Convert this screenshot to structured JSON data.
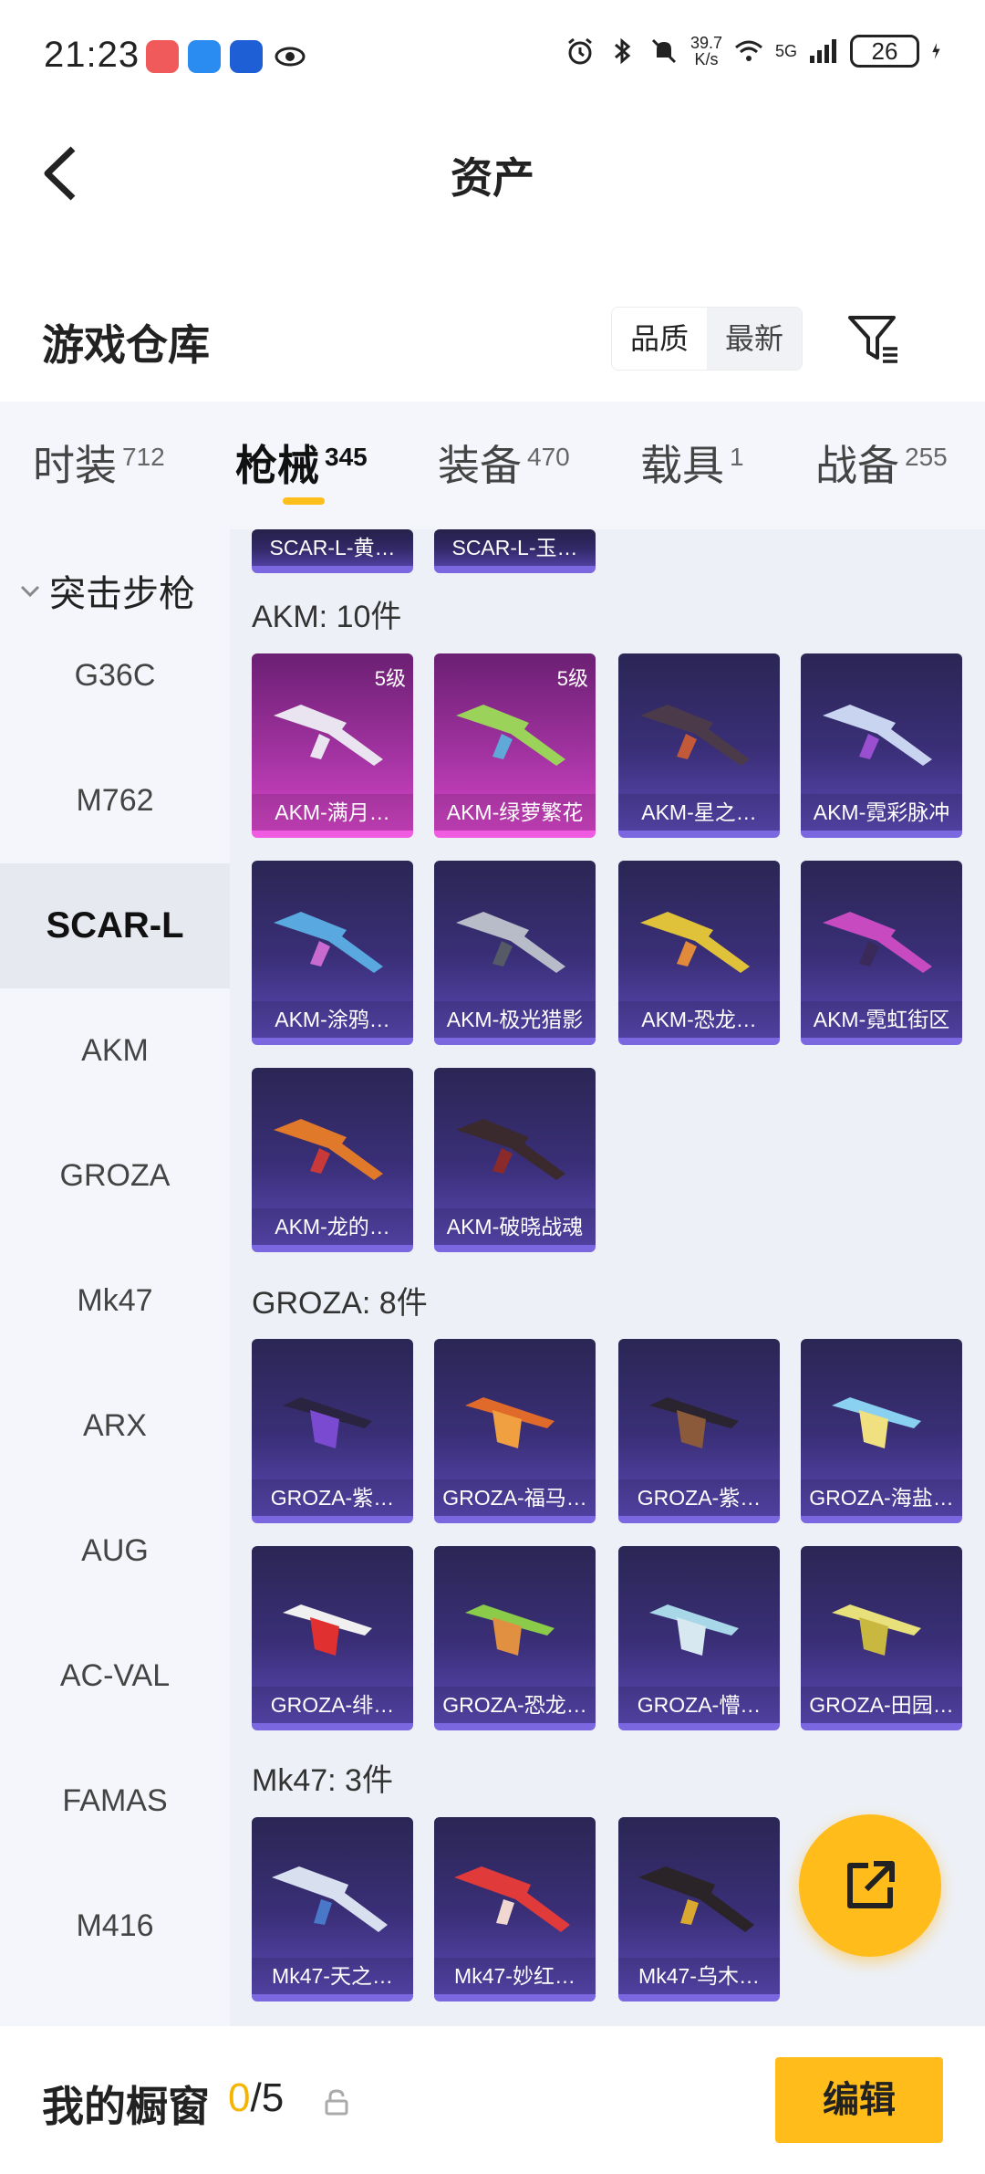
{
  "status_bar": {
    "time": "21:23",
    "net_speed_top": "39.7",
    "net_speed_bottom": "K/s",
    "signal": "5G",
    "battery": "26"
  },
  "header": {
    "title": "资产"
  },
  "warehouse": {
    "title": "游戏仓库",
    "sort_options": [
      "品质",
      "最新"
    ],
    "selected_sort": "品质"
  },
  "tabs": [
    {
      "label": "时装",
      "count": "712"
    },
    {
      "label": "枪械",
      "count": "345",
      "active": true
    },
    {
      "label": "装备",
      "count": "470"
    },
    {
      "label": "载具",
      "count": "1"
    },
    {
      "label": "战备",
      "count": "255"
    }
  ],
  "sidebar": {
    "group": "突击步枪",
    "items": [
      "G36C",
      "M762",
      "SCAR-L",
      "AKM",
      "GROZA",
      "Mk47",
      "ARX",
      "AUG",
      "AC-VAL",
      "FAMAS",
      "M416"
    ],
    "active": "SCAR-L"
  },
  "content": {
    "top_partial": [
      "SCAR-L-黄…",
      "SCAR-L-玉…"
    ],
    "sections": [
      {
        "title": "AKM: 10件",
        "items": [
          {
            "name": "AKM-满月…",
            "level": "5级",
            "rarity": "pink"
          },
          {
            "name": "AKM-绿萝繁花",
            "level": "5级",
            "rarity": "pink"
          },
          {
            "name": "AKM-星之…"
          },
          {
            "name": "AKM-霓彩脉冲"
          },
          {
            "name": "AKM-涂鸦…"
          },
          {
            "name": "AKM-极光猎影"
          },
          {
            "name": "AKM-恐龙…"
          },
          {
            "name": "AKM-霓虹街区"
          },
          {
            "name": "AKM-龙的…"
          },
          {
            "name": "AKM-破晓战魂"
          }
        ]
      },
      {
        "title": "GROZA: 8件",
        "items": [
          {
            "name": "GROZA-紫…"
          },
          {
            "name": "GROZA-福马…"
          },
          {
            "name": "GROZA-紫…"
          },
          {
            "name": "GROZA-海盐…"
          },
          {
            "name": "GROZA-绯…"
          },
          {
            "name": "GROZA-恐龙…"
          },
          {
            "name": "GROZA-懵…"
          },
          {
            "name": "GROZA-田园…"
          }
        ]
      },
      {
        "title": "Mk47: 3件",
        "items": [
          {
            "name": "Mk47-天之…"
          },
          {
            "name": "Mk47-妙红…"
          },
          {
            "name": "Mk47-乌木…"
          }
        ]
      }
    ]
  },
  "bottom_bar": {
    "label": "我的橱窗",
    "current": "0",
    "total": "/5",
    "edit_label": "编辑"
  },
  "colors": {
    "accent": "#ffbc1a",
    "card_purple": "#3a2f78",
    "card_pink": "#a0329f"
  }
}
